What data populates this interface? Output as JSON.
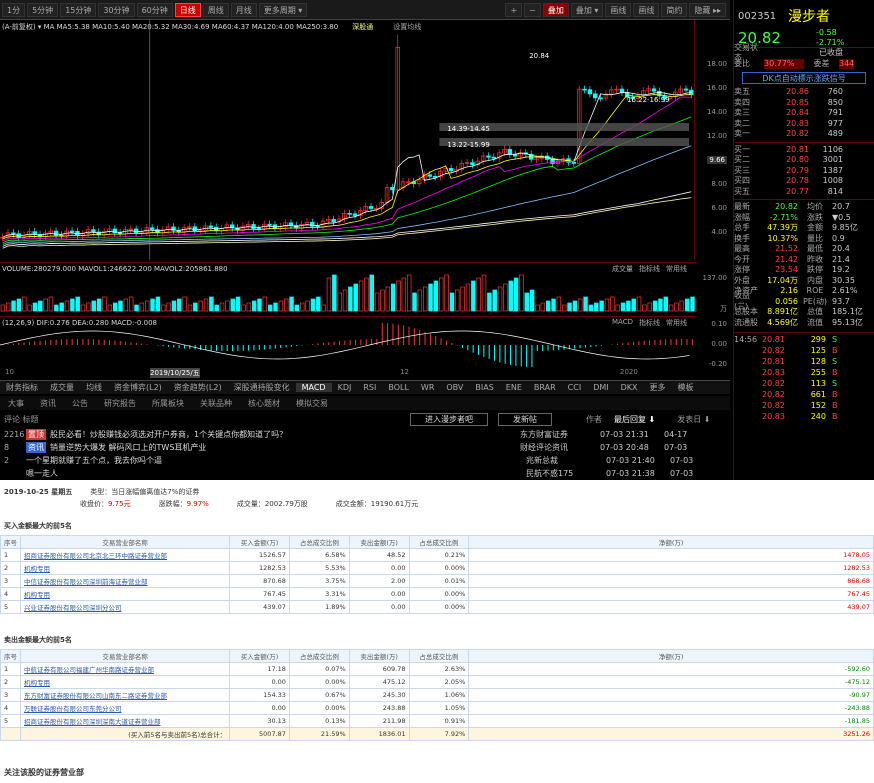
{
  "toolbar": {
    "left": [
      "1分",
      "5分钟",
      "15分钟",
      "30分钟",
      "60分钟",
      "日线",
      "周线",
      "月线",
      "更多周期 ▾"
    ],
    "active": "日线",
    "right": [
      "+",
      "−",
      "叠加",
      "叠加 ▾",
      "画线",
      "画线",
      "简约",
      "隐藏 ▸▸"
    ]
  },
  "legend": {
    "ma": "(A-前复权) ▾ MA  MA5:5.38  MA10:5.40  MA20:5.32  MA30:4.69  MA60:4.37  MA120:4.00  MA250:3.80",
    "badge": "深股通",
    "settings": "设置均线"
  },
  "chart_labels": {
    "high": "20.84",
    "t1": "16.22-16.99",
    "t2": "14.39-14.45",
    "t3": "13.22-15.99"
  },
  "yaxis": [
    "18.00",
    "16.00",
    "14.00",
    "12.00",
    "9.66",
    "8.00",
    "6.00",
    "4.00"
  ],
  "volume": {
    "legend": "VOLUME:280279.000  MAVOL1:246622.200  MAVOL2:205861.880",
    "ticks": [
      "137.00",
      "万"
    ],
    "btns": [
      "成交量",
      "指标线",
      "常用线"
    ]
  },
  "macd": {
    "legend": "(12,26,9) DIF:0.276  DEA:0.280  MACD:-0.008",
    "ticks": [
      "0.10",
      "0.00",
      "-0.20"
    ],
    "btns": [
      "MACD",
      "指标线",
      "常用线"
    ]
  },
  "dates": [
    "10",
    "2019/10/25/五",
    "12",
    "2020"
  ],
  "indicators": {
    "items": [
      "财务指标",
      "成交量",
      "均线",
      "资金博弈(L2)",
      "资金趋势(L2)",
      "深股通持股变化",
      "MACD",
      "KDJ",
      "RSI",
      "BOLL",
      "WR",
      "OBV",
      "BIAS",
      "ENE",
      "BRAR",
      "CCI",
      "DMI",
      "DKX",
      "更多",
      "模板"
    ],
    "active": "MACD"
  },
  "newstabs": [
    "大事",
    "资讯",
    "公告",
    "研究报告",
    "所属板块",
    "关联品种",
    "核心题材",
    "模拟交易"
  ],
  "newshdr": {
    "left": "评论  标题",
    "mid": "进入漫步者吧",
    "mid2": "发新帖",
    "author": "作者",
    "reply": "最后回复 ⬇",
    "time": "发表日 ⬇"
  },
  "news": [
    {
      "id": "2216",
      "tag": "置顶",
      "title": "股民必看！炒股赚钱必须选对开户券商，1个关键点你都知道了吗？",
      "author": "东方财富证券",
      "date": "07-03 21:31",
      "post": "04-17"
    },
    {
      "id": "8",
      "tag": "资讯",
      "title": "销量逆势大爆发 解码风口上的TWS耳机产业",
      "author": "财经评论资讯",
      "date": "07-03 20:48",
      "post": "07-03"
    },
    {
      "id": "2",
      "tag": "",
      "title": "一个星期就赚了五个点，我去你吗个逼",
      "author": "兆新总裁",
      "date": "07-03 21:40",
      "post": "07-03"
    },
    {
      "id": "",
      "tag": "",
      "title": "嗯一走人",
      "author": "民航不惑175",
      "date": "07-03 21:38",
      "post": "07-03"
    }
  ],
  "quote": {
    "code": "002351",
    "name": "漫步者",
    "price": "20.82",
    "chg": "-0.58",
    "pct": "-2.71%",
    "status": "交易状态",
    "status_v": "已收盘",
    "wb_l": "委比",
    "wb": "30.77%",
    "wc_l": "委差",
    "wc": "344",
    "link": "DK点自动標示涨跌信号",
    "asks": [
      [
        "卖五",
        "20.86",
        "760"
      ],
      [
        "卖四",
        "20.85",
        "850"
      ],
      [
        "卖三",
        "20.84",
        "791"
      ],
      [
        "卖二",
        "20.83",
        "977"
      ],
      [
        "卖一",
        "20.82",
        "489"
      ]
    ],
    "bids": [
      [
        "买一",
        "20.81",
        "1106"
      ],
      [
        "买二",
        "20.80",
        "3001"
      ],
      [
        "买三",
        "20.79",
        "1387"
      ],
      [
        "买四",
        "20.78",
        "1008"
      ],
      [
        "买五",
        "20.77",
        "814"
      ]
    ],
    "stats": [
      [
        "最新",
        "20.82",
        "均价",
        "20.7"
      ],
      [
        "涨幅",
        "-2.71%",
        "涨跌",
        "▼0.5"
      ],
      [
        "总手",
        "47.39万",
        "金额",
        "9.85亿"
      ],
      [
        "换手",
        "10.37%",
        "量比",
        "0.9"
      ],
      [
        "最高",
        "21.52",
        "最低",
        "20.4"
      ],
      [
        "今开",
        "21.42",
        "昨收",
        "21.4"
      ],
      [
        "涨停",
        "23.54",
        "跌停",
        "19.2"
      ],
      [
        "外盘",
        "17.04万",
        "内盘",
        "30.35"
      ],
      [
        "净资产",
        "2.16",
        "ROE",
        "2.61%"
      ],
      [
        "收益(三)",
        "0.056",
        "PE(动)",
        "93.7"
      ],
      [
        "总股本",
        "8.891亿",
        "总值",
        "185.1亿"
      ],
      [
        "流通股",
        "4.569亿",
        "流值",
        "95.13亿"
      ]
    ],
    "ticks": [
      [
        "14:56",
        "20.81",
        "299",
        "S"
      ],
      [
        "",
        "20.82",
        "125",
        "B"
      ],
      [
        "",
        "20.81",
        "128",
        "S"
      ],
      [
        "",
        "20.83",
        "255",
        "B"
      ],
      [
        "",
        "20.82",
        "113",
        "S"
      ],
      [
        "",
        "20.82",
        "661",
        "B"
      ],
      [
        "",
        "20.82",
        "152",
        "B"
      ],
      [
        "",
        "20.83",
        "240",
        "B"
      ]
    ]
  },
  "bottom": {
    "date": "2019-10-25 星期五",
    "type_l": "类型：当日涨幅偏离值达7%的证券",
    "close_l": "收盘价：",
    "close": "9.75元",
    "rise_l": "涨跌幅：",
    "rise": "9.97%",
    "vol_l": "成交量：",
    "vol": "2002.79万股",
    "amt_l": "成交金额：",
    "amt": "19190.61万元",
    "buy_title": "买入金额最大的前5名",
    "sell_title": "卖出金额最大的前5名",
    "cols": [
      "序号",
      "交易营业部名称",
      "买入金额(万)",
      "占总成交比例",
      "卖出金额(万)",
      "占总成交比例",
      "净额(万)"
    ],
    "buy": [
      [
        "1",
        "招商证券股份有限公司北京北三环中路证券营业部",
        "1526.57",
        "6.58%",
        "48.52",
        "0.21%",
        "1478.05"
      ],
      [
        "2",
        "机构专用",
        "1282.53",
        "5.53%",
        "0.00",
        "0.00%",
        "1282.53"
      ],
      [
        "3",
        "中信证券股份有限公司深圳前海证券营业部",
        "870.68",
        "3.75%",
        "2.00",
        "0.01%",
        "868.68"
      ],
      [
        "4",
        "机构专用",
        "767.45",
        "3.31%",
        "0.00",
        "0.00%",
        "767.45"
      ],
      [
        "5",
        "兴业证券股份有限公司深圳分公司",
        "439.07",
        "1.89%",
        "0.00",
        "0.00%",
        "439.07"
      ]
    ],
    "sell": [
      [
        "1",
        "中航证券有限公司福建广州华南路证券营业部",
        "17.18",
        "0.07%",
        "609.78",
        "2.63%",
        "-592.60"
      ],
      [
        "2",
        "机构专用",
        "0.00",
        "0.00%",
        "475.12",
        "2.05%",
        "-475.12"
      ],
      [
        "3",
        "东方财富证券股份有限公司山南东二路证券营业部",
        "154.33",
        "0.67%",
        "245.30",
        "1.06%",
        "-90.97"
      ],
      [
        "4",
        "万联证券股份有限公司东莞分公司",
        "0.00",
        "0.00%",
        "243.88",
        "1.05%",
        "-243.88"
      ],
      [
        "5",
        "招商证券股份有限公司深圳深南大道证券营业部",
        "30.13",
        "0.13%",
        "211.98",
        "0.91%",
        "-181.85"
      ]
    ],
    "total": [
      "",
      "(买入前5名与卖出前5名)总合计：",
      "5007.87",
      "21.59%",
      "1836.01",
      "7.92%",
      "3251.26"
    ],
    "footer": "关注该股的证券营业部"
  },
  "chart_data": {
    "type": "candlestick",
    "note": "K-line with MA lines, volume and MACD panels"
  }
}
